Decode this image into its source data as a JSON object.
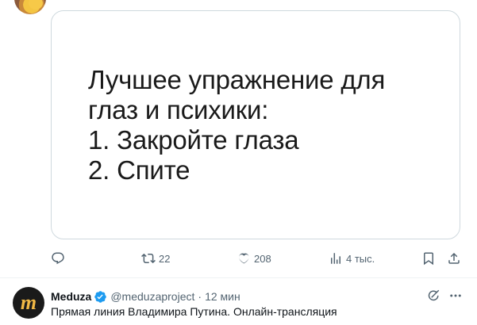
{
  "media": {
    "lines": [
      "Лучшее упражнение для",
      "глаз и психики:",
      "1. Закройте глаза",
      "2. Спите"
    ]
  },
  "actions": {
    "reply_icon": "reply-icon",
    "retweet_count": "22",
    "like_count": "208",
    "views_count": "4 тыс.",
    "bookmark_icon": "bookmark-icon",
    "share_icon": "share-icon"
  },
  "next_tweet": {
    "avatar_letter": "m",
    "author": "Meduza",
    "handle": "@meduzaproject",
    "separator": "·",
    "time": "12 мин",
    "text": "Прямая линия Владимира Путина. Онлайн-трансляция"
  },
  "colors": {
    "muted": "#536471",
    "verified": "#1d9bf0",
    "border": "#cfd9de"
  }
}
